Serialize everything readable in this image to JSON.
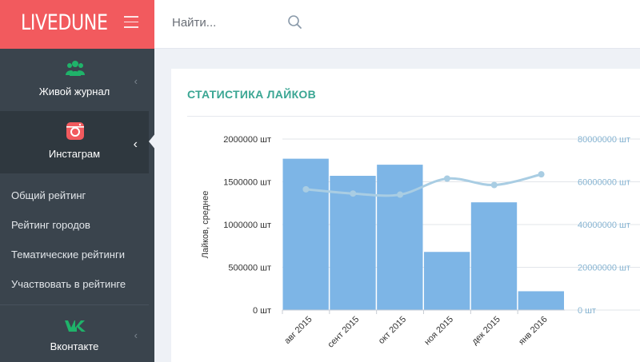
{
  "brand": {
    "logo_text": "LIVEDUNE"
  },
  "search": {
    "placeholder": "Найти..."
  },
  "sidebar": {
    "sections": [
      {
        "label": "Живой журнал",
        "icon": "users-icon",
        "color": "#1fb36a"
      },
      {
        "label": "Инстаграм",
        "icon": "instagram-icon",
        "color": "#f25a5e",
        "active": true
      },
      {
        "label": "Вконтакте",
        "icon": "vk-icon",
        "color": "#1fb36a"
      }
    ],
    "submenu": [
      "Общий рейтинг",
      "Рейтинг городов",
      "Тематические рейтинги",
      "Участвовать в рейтинге"
    ]
  },
  "card": {
    "title": "СТАТИСТИКА ЛАЙКОВ"
  },
  "colors": {
    "accent": "#f25a5e",
    "bar": "#7db5e6",
    "line": "#a9cde3",
    "title": "#3aa693"
  },
  "chart_data": {
    "type": "bar",
    "title": "",
    "ylabel": "Лайков, среднее",
    "categories": [
      "авг 2015",
      "сент 2015",
      "окт 2015",
      "ноя 2015",
      "дек 2015",
      "янв 2016"
    ],
    "series": [
      {
        "axis": "left",
        "type": "bar",
        "values": [
          1770000,
          1570000,
          1700000,
          680000,
          1260000,
          220000
        ]
      },
      {
        "axis": "right",
        "type": "line",
        "values": [
          56500000,
          54500000,
          54000000,
          61500000,
          58500000,
          63500000
        ]
      }
    ],
    "y_left": {
      "ticks": [
        "2000000 шт",
        "1500000 шт",
        "1000000 шт",
        "500000 шт",
        "0 шт"
      ],
      "ylim": [
        0,
        2000000
      ]
    },
    "y_right": {
      "ticks": [
        "80000000 шт",
        "60000000 шт",
        "40000000 шт",
        "20000000 шт",
        "0 шт"
      ],
      "ylim": [
        0,
        80000000
      ]
    },
    "grid": true
  }
}
